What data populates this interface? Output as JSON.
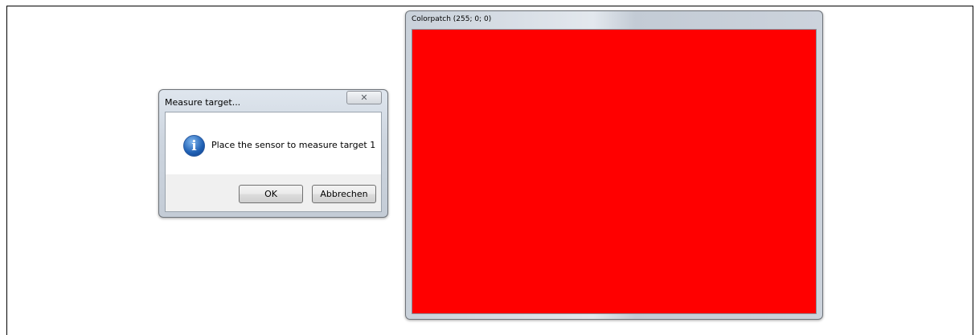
{
  "measure_dialog": {
    "title": "Measure target...",
    "close_glyph": "✕",
    "icon": "info-icon",
    "info_glyph": "i",
    "message": "Place the sensor to measure target 1",
    "ok_label": "OK",
    "cancel_label": "Abbrechen"
  },
  "colorpatch_window": {
    "title": "Colorpatch (255; 0; 0)",
    "patch_color": "#ff0000"
  }
}
